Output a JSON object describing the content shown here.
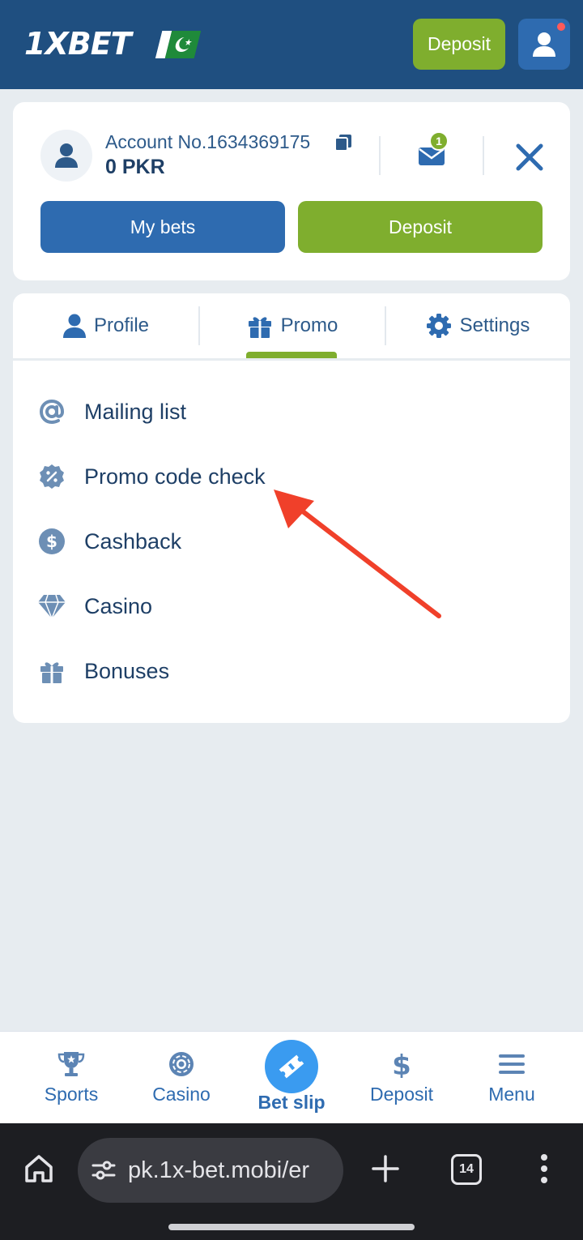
{
  "header": {
    "logo_text": "1XBET",
    "deposit_label": "Deposit",
    "colors": {
      "header_bg": "#1f4f80",
      "accent_green": "#7fae2e",
      "accent_blue": "#2e6bb0"
    }
  },
  "account": {
    "account_number": "Account No.1634369175",
    "balance": "0 PKR",
    "unread_messages": "1",
    "my_bets_label": "My bets",
    "deposit_label": "Deposit"
  },
  "tabs": [
    {
      "label": "Profile",
      "icon": "person-icon"
    },
    {
      "label": "Promo",
      "icon": "gift-icon",
      "active": true
    },
    {
      "label": "Settings",
      "icon": "gear-icon"
    }
  ],
  "promo_items": [
    {
      "label": "Mailing list",
      "icon": "at-sign-icon"
    },
    {
      "label": "Promo code check",
      "icon": "percent-badge-icon"
    },
    {
      "label": "Cashback",
      "icon": "dollar-coin-icon"
    },
    {
      "label": "Casino",
      "icon": "diamond-icon"
    },
    {
      "label": "Bonuses",
      "icon": "gift-icon"
    }
  ],
  "bottom_nav": [
    {
      "label": "Sports",
      "icon": "trophy-icon"
    },
    {
      "label": "Casino",
      "icon": "casino-chip-icon"
    },
    {
      "label": "Bet slip",
      "icon": "ticket-icon",
      "active": true
    },
    {
      "label": "Deposit",
      "icon": "dollar-icon"
    },
    {
      "label": "Menu",
      "icon": "hamburger-icon"
    }
  ],
  "browser": {
    "url": "pk.1x-bet.mobi/er",
    "tab_count": "14"
  }
}
